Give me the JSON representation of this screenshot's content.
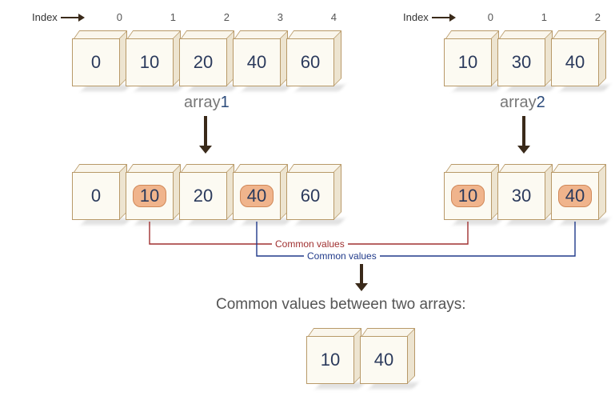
{
  "indexLabel": "Index",
  "array1": {
    "name": "array",
    "num": "1",
    "indices": [
      "0",
      "1",
      "2",
      "3",
      "4"
    ],
    "values": [
      "0",
      "10",
      "20",
      "40",
      "60"
    ],
    "highlighted": [
      false,
      true,
      false,
      true,
      false
    ]
  },
  "array2": {
    "name": "array",
    "num": "2",
    "indices": [
      "0",
      "1",
      "2"
    ],
    "values": [
      "10",
      "30",
      "40"
    ],
    "highlighted": [
      true,
      false,
      true
    ]
  },
  "commonValuesLabel1": "Common values",
  "commonValuesLabel2": "Common values",
  "resultTitle": "Common values between two arrays:",
  "result": [
    "10",
    "40"
  ],
  "colors": {
    "connector1": "#a03030",
    "connector2": "#203a8a"
  }
}
